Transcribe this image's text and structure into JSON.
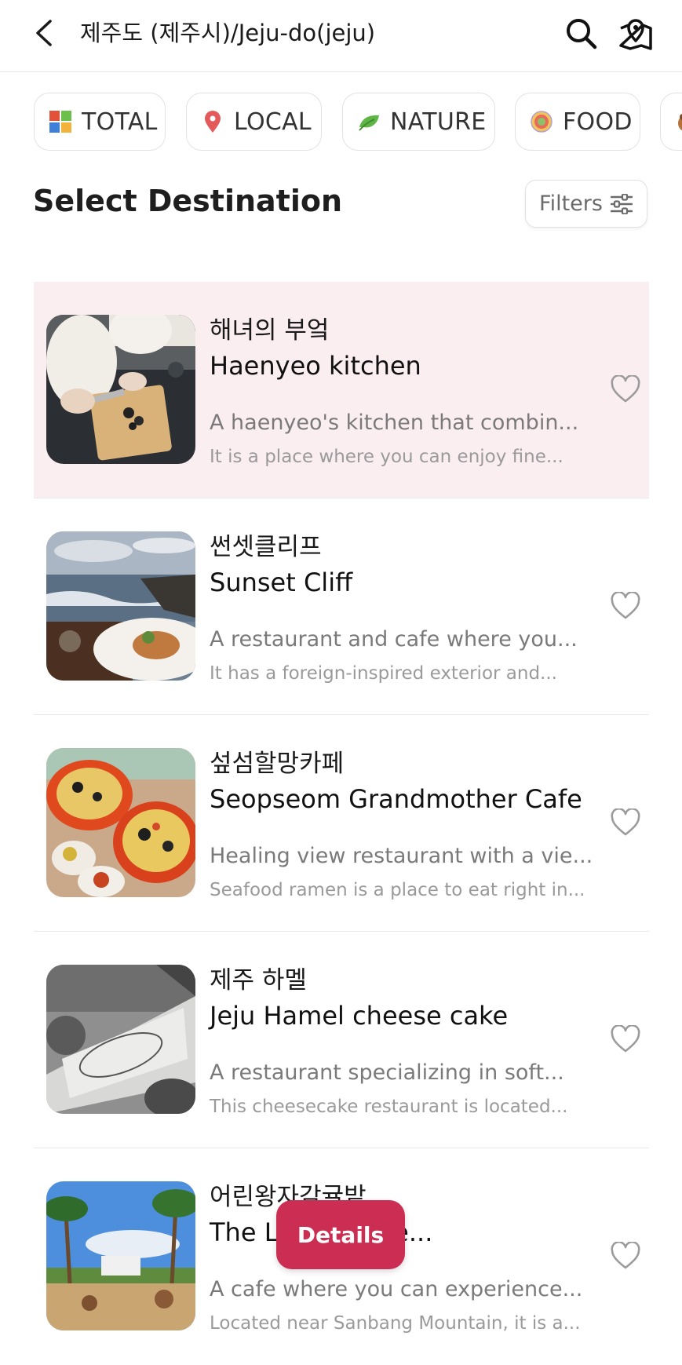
{
  "header": {
    "title": "제주도 (제주시)/Jeju-do(jeju)",
    "back_icon": "chevron-left-icon",
    "search_icon": "search-icon",
    "map_icon": "map-pin-icon"
  },
  "categories": [
    {
      "label": "TOTAL",
      "icon": "grid-icon"
    },
    {
      "label": "LOCAL",
      "icon": "location-pin-icon"
    },
    {
      "label": "NATURE",
      "icon": "leaf-icon"
    },
    {
      "label": "FOOD",
      "icon": "plate-icon"
    }
  ],
  "section": {
    "title": "Select Destination",
    "filters_label": "Filters",
    "filters_icon": "sliders-icon"
  },
  "items": [
    {
      "name_ko": "해녀의 부엌",
      "name_en": "Haenyeo kitchen",
      "description": "A haenyeo's kitchen that combin...",
      "subtext": "It is a place where you can enjoy fine...",
      "highlighted": true
    },
    {
      "name_ko": "썬셋클리프",
      "name_en": "Sunset Cliff",
      "description": "A restaurant and cafe where you...",
      "subtext": "It has a foreign-inspired exterior and..."
    },
    {
      "name_ko": "섶섬할망카페",
      "name_en": "Seopseom Grandmother Cafe",
      "description": "Healing view restaurant with a vie...",
      "subtext": "Seafood ramen is a place to eat right in..."
    },
    {
      "name_ko": "제주 하멜",
      "name_en": "Jeju Hamel cheese cake",
      "description": "A restaurant specializing in soft...",
      "subtext": "This cheesecake restaurant is located..."
    },
    {
      "name_ko": "어린왕자감귤밭",
      "name_en": "The L Tangerine...",
      "description": "A cafe where you can experience...",
      "subtext": "Located near Sanbang Mountain, it is a..."
    }
  ],
  "details_button": {
    "label": "Details"
  },
  "colors": {
    "accent": "#cc2d52",
    "highlight_bg": "#fbeef1",
    "text_primary": "#1a1a1a",
    "text_secondary": "#7a7a7a"
  }
}
